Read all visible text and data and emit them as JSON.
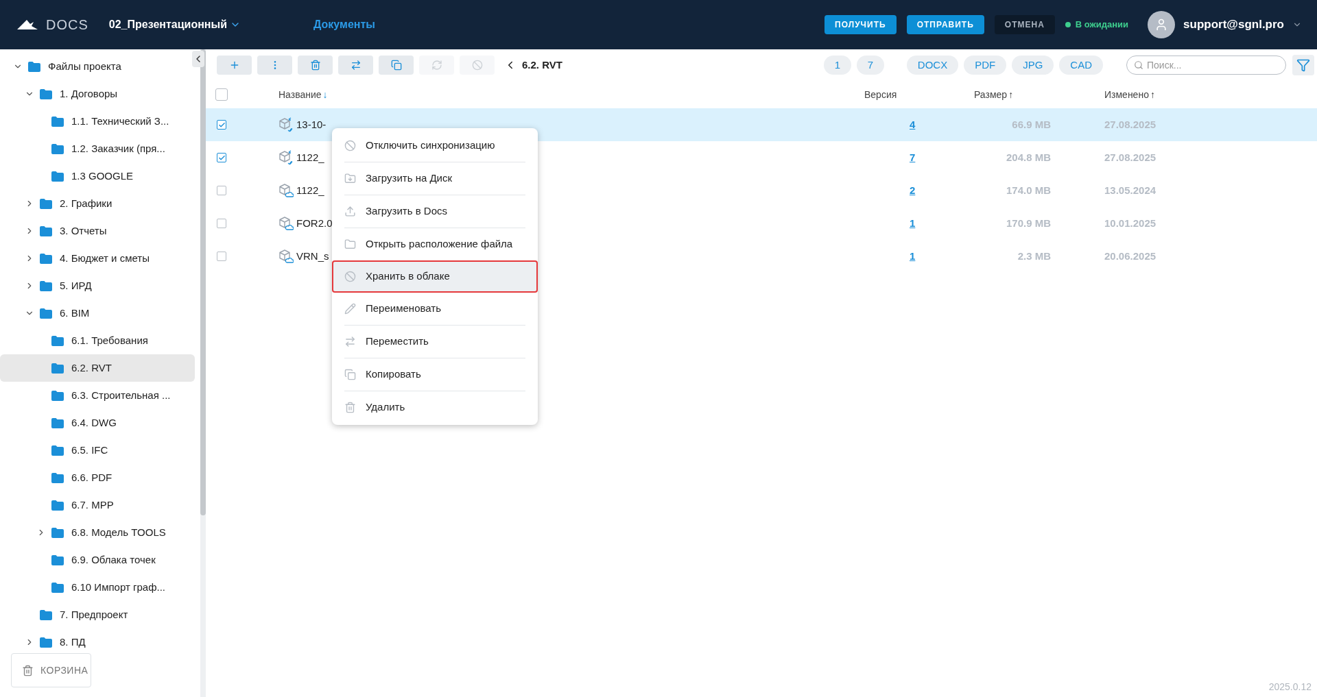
{
  "header": {
    "logo_text": "DOCS",
    "project": "02_Презентационный",
    "nav_link": "Документы",
    "buttons": [
      {
        "label": "ПОЛУЧИТЬ",
        "kind": "primary"
      },
      {
        "label": "ОТПРАВИТЬ",
        "kind": "primary"
      },
      {
        "label": "ОТМЕНА",
        "kind": "dark"
      }
    ],
    "status": {
      "label": "В ожидании",
      "color": "#3ecf8e"
    },
    "user": "support@sgnl.pro"
  },
  "sidebar": {
    "tree": [
      {
        "label": "Файлы проекта",
        "expanded": true,
        "selected": false,
        "children": [
          {
            "label": "1. Договоры",
            "expanded": true,
            "selected": false,
            "children": [
              {
                "label": "1.1. Технический З...",
                "selected": false
              },
              {
                "label": "1.2. Заказчик (пря...",
                "selected": false
              },
              {
                "label": "1.3 GOOGLE",
                "selected": false
              }
            ]
          },
          {
            "label": "2. Графики",
            "expanded": false,
            "selected": false
          },
          {
            "label": "3. Отчеты",
            "expanded": false,
            "selected": false
          },
          {
            "label": "4. Бюджет и сметы",
            "expanded": false,
            "selected": false
          },
          {
            "label": "5. ИРД",
            "expanded": false,
            "selected": false
          },
          {
            "label": "6. BIM",
            "expanded": true,
            "selected": false,
            "children": [
              {
                "label": "6.1. Требования",
                "selected": false
              },
              {
                "label": "6.2. RVT",
                "selected": true
              },
              {
                "label": "6.3. Строительная ...",
                "selected": false
              },
              {
                "label": "6.4. DWG",
                "selected": false
              },
              {
                "label": "6.5. IFC",
                "selected": false
              },
              {
                "label": "6.6. PDF",
                "selected": false
              },
              {
                "label": "6.7. MPP",
                "selected": false
              },
              {
                "label": "6.8. Модель TOOLS",
                "expanded": false,
                "selected": false
              },
              {
                "label": "6.9. Облака точек",
                "selected": false
              },
              {
                "label": "6.10 Импорт граф...",
                "selected": false
              }
            ]
          },
          {
            "label": "7. Предпроект",
            "selected": false
          },
          {
            "label": "8. ПД",
            "expanded": false,
            "selected": false
          }
        ]
      }
    ],
    "trash_button": "КОРЗИНА"
  },
  "toolbar": {
    "actions": [
      {
        "kind": "add",
        "disabled": false
      },
      {
        "kind": "more",
        "disabled": false
      },
      {
        "kind": "delete",
        "disabled": false
      },
      {
        "kind": "move",
        "disabled": false
      },
      {
        "kind": "copy",
        "disabled": false
      },
      {
        "kind": "sync",
        "disabled": true
      },
      {
        "kind": "block",
        "disabled": true
      }
    ],
    "breadcrumb": "6.2. RVT",
    "version_chips": [
      "1",
      "7"
    ],
    "format_chips": [
      "DOCX",
      "PDF",
      "JPG",
      "CAD"
    ],
    "search": {
      "placeholder": "Поиск..."
    }
  },
  "table": {
    "all_checked": false,
    "columns": [
      {
        "label": "Название",
        "sort": "↓",
        "active": true
      },
      {
        "label": "Версия"
      },
      {
        "label": "Размер",
        "sort": "↑",
        "active": false
      },
      {
        "label": "Изменено",
        "sort": "↑",
        "active": false
      }
    ],
    "rows": [
      {
        "name": "13-10-",
        "checked": true,
        "selected": true,
        "kind": "synced",
        "version": "4",
        "size": "66.9 MB",
        "modified": "27.08.2025"
      },
      {
        "name": "1122_",
        "checked": true,
        "selected": false,
        "kind": "synced",
        "version": "7",
        "size": "204.8 MB",
        "modified": "27.08.2025"
      },
      {
        "name": "1122_",
        "checked": false,
        "selected": false,
        "kind": "cloud",
        "version": "2",
        "size": "174.0 MB",
        "modified": "13.05.2024"
      },
      {
        "name": "FOR2.0",
        "checked": false,
        "selected": false,
        "kind": "cloud",
        "version": "1",
        "size": "170.9 MB",
        "modified": "10.01.2025"
      },
      {
        "name": "VRN_s",
        "checked": false,
        "selected": false,
        "kind": "cloud",
        "version": "1",
        "size": "2.3 MB",
        "modified": "20.06.2025"
      }
    ]
  },
  "context_menu": {
    "items": [
      {
        "label": "Отключить синхронизацию",
        "kind": "block",
        "hovered": false
      },
      {
        "label": "Загрузить на Диск",
        "kind": "download",
        "hovered": false
      },
      {
        "label": "Загрузить в Docs",
        "kind": "upload",
        "hovered": false
      },
      {
        "label": "Открыть расположение файла",
        "kind": "folder",
        "hovered": false
      },
      {
        "label": "Хранить в облаке",
        "kind": "block",
        "hovered": true
      },
      {
        "label": "Переименовать",
        "kind": "rename",
        "hovered": false
      },
      {
        "label": "Переместить",
        "kind": "move",
        "hovered": false
      },
      {
        "label": "Копировать",
        "kind": "copy",
        "hovered": false
      },
      {
        "label": "Удалить",
        "kind": "delete",
        "hovered": false
      }
    ]
  },
  "app_version": "2025.0.12"
}
